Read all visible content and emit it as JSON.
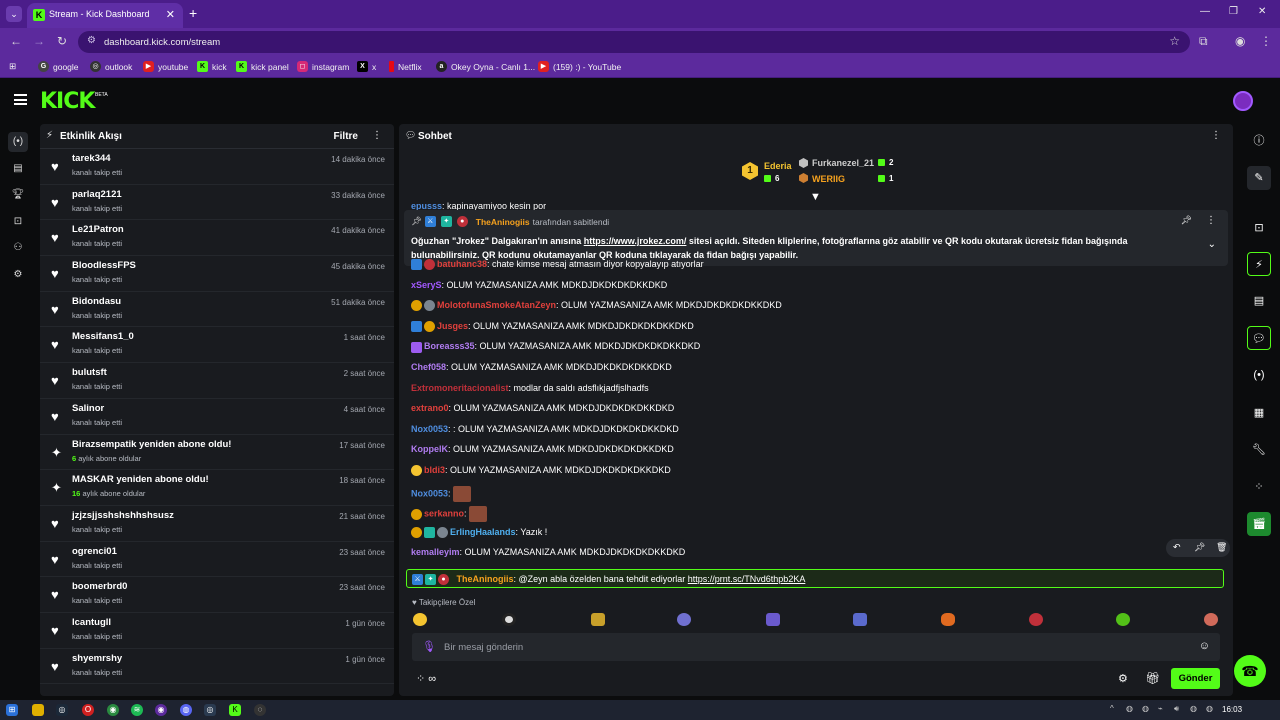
{
  "browser": {
    "tab_title": "Stream - Kick Dashboard",
    "url": "dashboard.kick.com/stream",
    "bookmarks": [
      "google",
      "outlook",
      "youtube",
      "kick",
      "kick panel",
      "instagram",
      "x",
      "Netflix",
      "Okey Oyna - Canlı 1...",
      "(159) :) - YouTube"
    ]
  },
  "header": {
    "logo": "KICK",
    "beta": "BETA"
  },
  "activity": {
    "title": "Etkinlik Akışı",
    "filter_label": "Filtre",
    "items": [
      {
        "name": "tarek344",
        "sub": "kanalı takip etti",
        "time": "14 dakika önce",
        "type": "follow"
      },
      {
        "name": "parlaq2121",
        "sub": "kanalı takip etti",
        "time": "33 dakika önce",
        "type": "follow"
      },
      {
        "name": "Le21Patron",
        "sub": "kanalı takip etti",
        "time": "41 dakika önce",
        "type": "follow"
      },
      {
        "name": "BloodlessFPS",
        "sub": "kanalı takip etti",
        "time": "45 dakika önce",
        "type": "follow"
      },
      {
        "name": "Bidondasu",
        "sub": "kanalı takip etti",
        "time": "51 dakika önce",
        "type": "follow"
      },
      {
        "name": "Messifans1_0",
        "sub": "kanalı takip etti",
        "time": "1 saat önce",
        "type": "follow"
      },
      {
        "name": "bulutsft",
        "sub": "kanalı takip etti",
        "time": "2 saat önce",
        "type": "follow"
      },
      {
        "name": "Salinor",
        "sub": "kanalı takip etti",
        "time": "4 saat önce",
        "type": "follow"
      },
      {
        "name": "Birazsempatik yeniden abone oldu!",
        "sub_count": "6",
        "sub": "aylık abone oldular",
        "time": "17 saat önce",
        "type": "sub"
      },
      {
        "name": "MASKAR yeniden abone oldu!",
        "sub_count": "16",
        "sub": "aylık abone oldular",
        "time": "18 saat önce",
        "type": "sub"
      },
      {
        "name": "jzjzsjjsshshshhshsusz",
        "sub": "kanalı takip etti",
        "time": "21 saat önce",
        "type": "follow"
      },
      {
        "name": "ogrenci01",
        "sub": "kanalı takip etti",
        "time": "23 saat önce",
        "type": "follow"
      },
      {
        "name": "boomerbrd0",
        "sub": "kanalı takip etti",
        "time": "23 saat önce",
        "type": "follow"
      },
      {
        "name": "lcantugll",
        "sub": "kanalı takip etti",
        "time": "1 gün önce",
        "type": "follow"
      },
      {
        "name": "shyemrshy",
        "sub": "kanalı takip etti",
        "time": "1 gün önce",
        "type": "follow"
      }
    ]
  },
  "chat": {
    "title": "Sohbet",
    "leaderboard": {
      "first": {
        "rank": "1",
        "name": "Ederia",
        "count": "6"
      },
      "second": {
        "name": "Furkanezel_21",
        "count": "2"
      },
      "third": {
        "name": "WERIIG",
        "count": "1"
      }
    },
    "pinned": {
      "user": "TheAninogiis",
      "by_text": "tarafından sabitlendi",
      "text_pre": "Oğuzhan \"Jrokez\" Dalgakıran'ın anısına ",
      "link": "https://www.jrokez.com/",
      "text_post": " sitesi açıldı. Siteden kliplerine, fotoğraflarına göz atabilir ve QR kodu okutarak ücretsiz fidan bağışında bulunabilirsiniz. QR kodunu okutamayanlar QR koduna tıklayarak da fidan bağışı yapabilir."
    },
    "partial_top": {
      "user": "epusss",
      "text": ": kapinayamiyoo kesin por"
    },
    "messages": [
      {
        "user": "batuhanc38",
        "color": "#e0403c",
        "text": ": chate kimse mesaj atmasın diyor kopyalayıp atıyorlar"
      },
      {
        "user": "xSeryS",
        "color": "#a259ff",
        "text": ": OLUM YAZMASANIZA AMK MDKDJDKDKDKDKKDKD"
      },
      {
        "user": "MolotofunaSmokeAtanZeyn",
        "color": "#e0403c",
        "text": ": OLUM YAZMASANIZA AMK MDKDJDKDKDKDKKDKD"
      },
      {
        "user": "Jusges",
        "color": "#e0403c",
        "text": ": OLUM YAZMASANIZA AMK MDKDJDKDKDKDKKDKD"
      },
      {
        "user": "Boreasss35",
        "color": "#b07cf0",
        "text": ": OLUM YAZMASANIZA AMK MDKDJDKDKDKDKKDKD"
      },
      {
        "user": "Chef058",
        "color": "#b07cf0",
        "text": ": OLUM YAZMASANIZA AMK MDKDJDKDKDKDKKDKD"
      },
      {
        "user": "Extromoneritacionalist",
        "color": "#c0303a",
        "text": ": modlar da saldı adsflıkjadfjslhadfs"
      },
      {
        "user": "extrano0",
        "color": "#e0403c",
        "text": ": OLUM YAZMASANIZA AMK MDKDJDKDKDKDKKDKD"
      },
      {
        "user": "Nox0053",
        "color": "#4f8ee0",
        "text": ": : OLUM YAZMASANIZA AMK MDKDJDKDKDKDKKDKD"
      },
      {
        "user": "KoppelK",
        "color": "#b07cf0",
        "text": ": OLUM YAZMASANIZA AMK MDKDJDKDKDKDKKDKD"
      },
      {
        "user": "bldi3",
        "color": "#e0403c",
        "text": ": OLUM YAZMASANIZA AMK MDKDJDKDKDKDKKDKD"
      },
      {
        "user": "Nox0053",
        "color": "#4f8ee0",
        "text": ":"
      },
      {
        "user": "serkanno",
        "color": "#e0403c",
        "text": ":"
      },
      {
        "user": "ErlingHaalands",
        "color": "#4fb0f0",
        "text": ": Yazık !"
      },
      {
        "user": "kemalleyim",
        "color": "#b07cf0",
        "text": ": OLUM YAZMASANIZA AMK MDKDJDKDKDKDKKDKD"
      }
    ],
    "highlight": {
      "user": "TheAninogiis",
      "text": ": @Zeyn abla özelden bana tehdit ediyorlar ",
      "link": "https://prnt.sc/TNvd6thpb2KA"
    },
    "follower_emotes_label": "Takipçilere Özel",
    "input_placeholder": "Bir mesaj gönderin",
    "send_label": "Gönder"
  },
  "taskbar": {
    "clock": "16:03"
  },
  "colors": {
    "accent": "#53fc18",
    "browser": "#5c2a9d",
    "panel": "#191b1f"
  }
}
